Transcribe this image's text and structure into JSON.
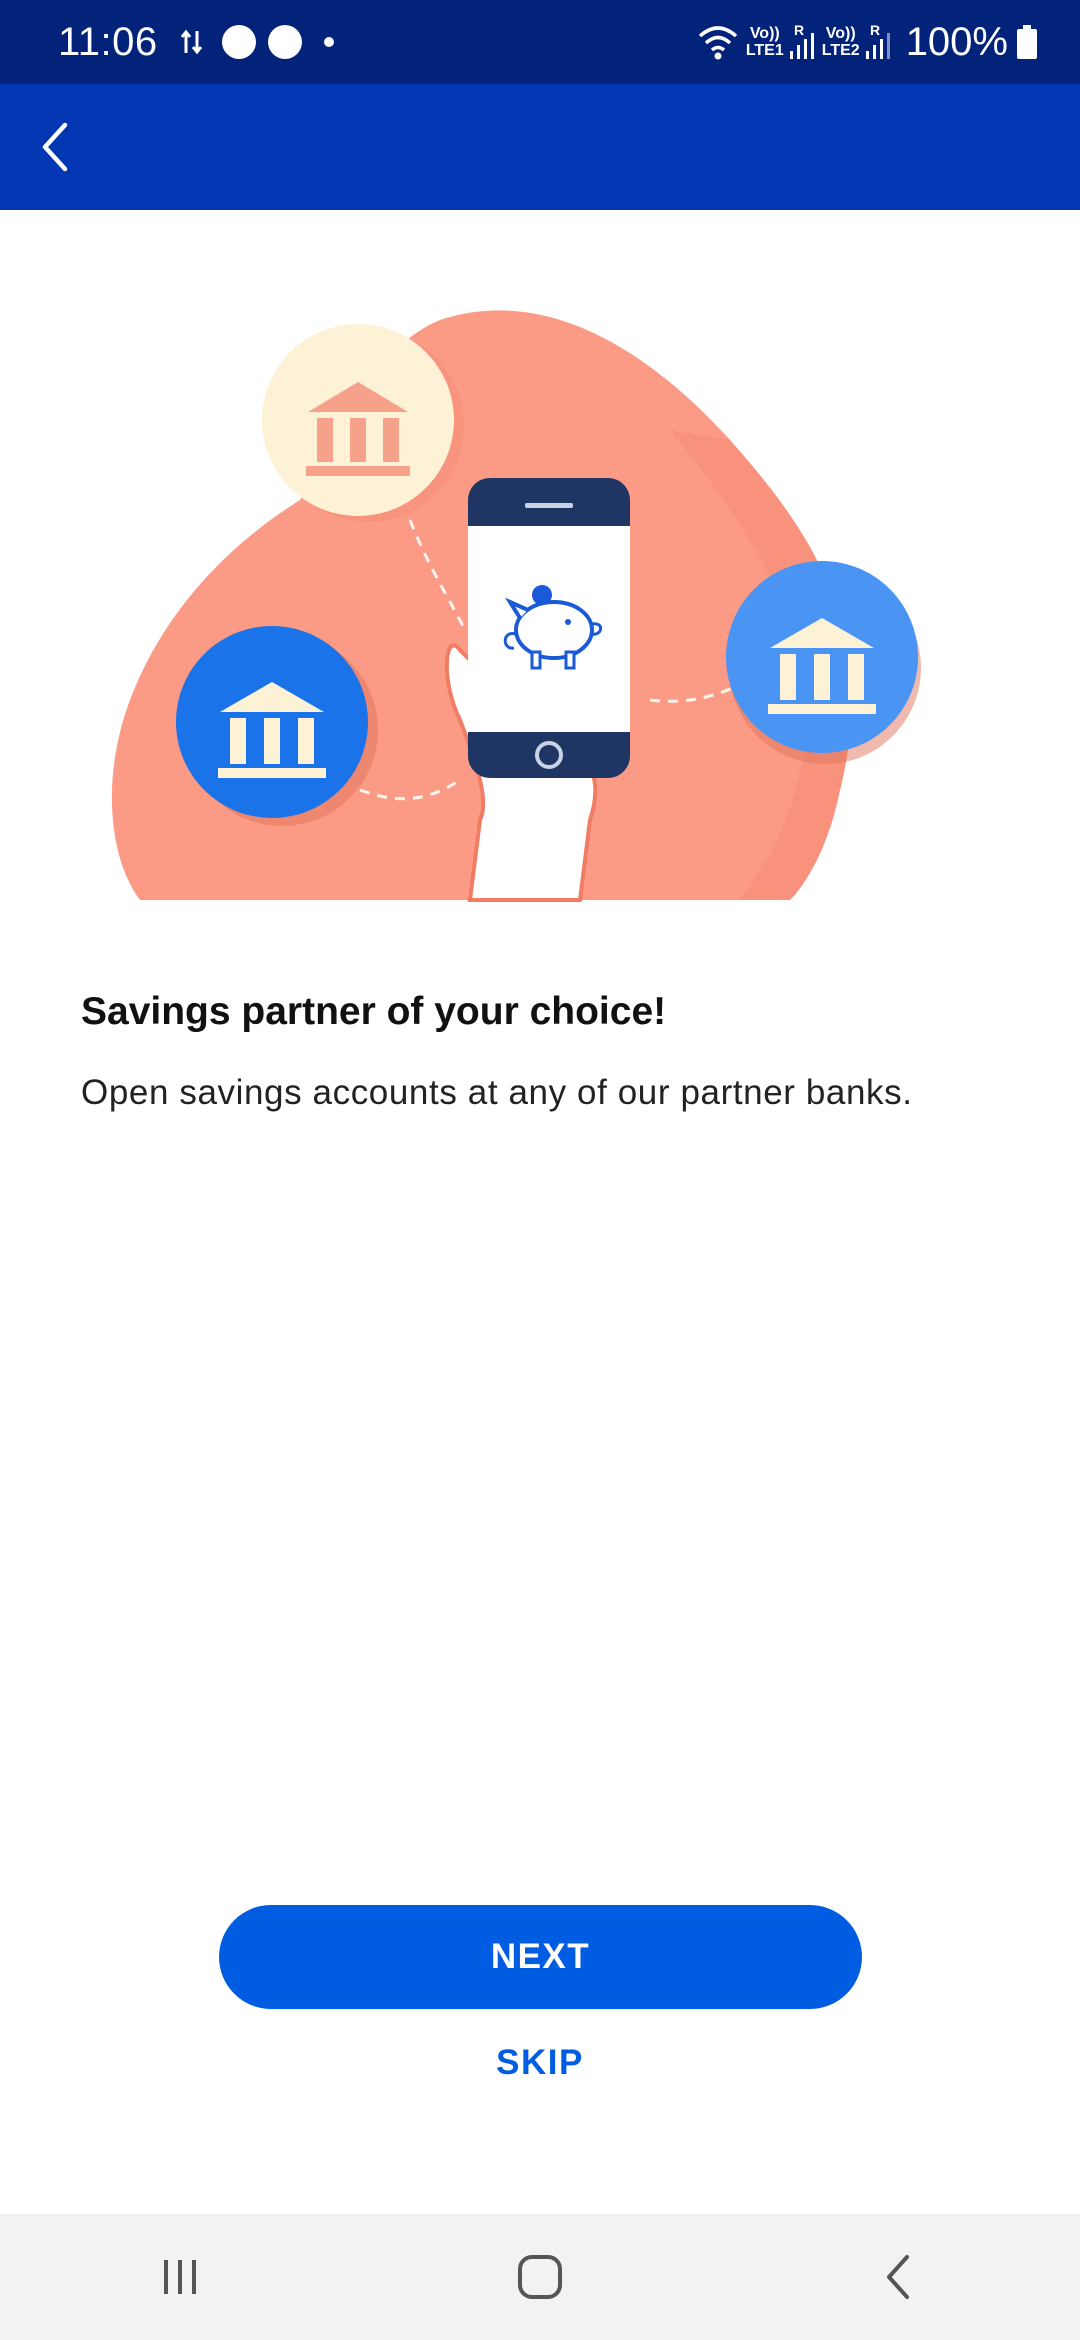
{
  "status_bar": {
    "time": "11:06",
    "sim1_label_top": "Vo))",
    "sim1_label_bottom": "LTE1",
    "sim2_label_top": "Vo))",
    "sim2_label_bottom": "LTE2",
    "roaming": "R",
    "battery": "100%"
  },
  "app_bar": {
    "back_icon": "chevron-left-icon"
  },
  "onboarding": {
    "title": "Savings partner of your choice!",
    "subtitle": "Open savings accounts at any of our partner banks."
  },
  "actions": {
    "next_label": "NEXT",
    "skip_label": "SKIP"
  },
  "nav_bar": {
    "recents_icon": "recent-apps-icon",
    "home_icon": "home-icon",
    "back_icon": "back-icon"
  },
  "colors": {
    "status_bar": "#03237a",
    "app_bar": "#0236b3",
    "accent": "#005ce0",
    "blob": "#fb9b85",
    "bank_blue": "#1a73e8",
    "bank_cream": "#fdf1d6"
  }
}
